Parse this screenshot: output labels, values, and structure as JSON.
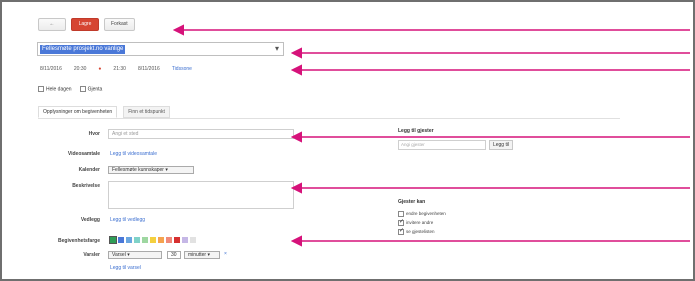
{
  "toolbar": {
    "back_label": "←",
    "save_label": "Lagre",
    "discard_label": "Forkast"
  },
  "title_field": {
    "value": "Fellesmøte prosjekt.no vanlige"
  },
  "time_row": {
    "start_date": "8/11/2016",
    "start_time": "20:30",
    "end_time": "21:30",
    "end_date": "8/11/2016",
    "timezone_link": "Tidssone"
  },
  "checkboxes": {
    "all_day": "Hele dagen",
    "repeat": "Gjenta"
  },
  "tabs": {
    "details": "Opplysninger om begivenheten",
    "find_time": "Finn et tidspunkt"
  },
  "form": {
    "where_label": "Hvor",
    "where_placeholder": "Angi et sted",
    "videocall_label": "Videosamtale",
    "videocall_link": "Legg til videosamtale",
    "calendar_label": "Kalender",
    "calendar_value": "Fellesmøte kunnskaper",
    "description_label": "Beskrivelse",
    "attachment_label": "Vedlegg",
    "attachment_link": "Legg til vedlegg",
    "color_label": "Begivenhetsfarge",
    "notification_label": "Varsler",
    "notification_type": "Varsel",
    "notification_amount": "30",
    "notification_unit": "minutter",
    "notification_add_link": "Legg til varsel"
  },
  "guests": {
    "title": "Legg til gjester",
    "input_placeholder": "Angi gjester",
    "add_button": "Legg til",
    "permissions_title": "Gjester kan",
    "perm_modify": "endre begivenheten",
    "perm_invite": "invitere andre",
    "perm_see_list": "se gjestelisten"
  },
  "colors": {
    "accent": "#d64532",
    "arrow": "#d6127a",
    "swatches": [
      "#2f9e57",
      "#4a78d8",
      "#6aa6e0",
      "#7fd2c8",
      "#9ed7a1",
      "#f4d03f",
      "#f5a34f",
      "#f08a7a",
      "#d63030",
      "#c5b7e6",
      "#e2e2e2"
    ]
  }
}
